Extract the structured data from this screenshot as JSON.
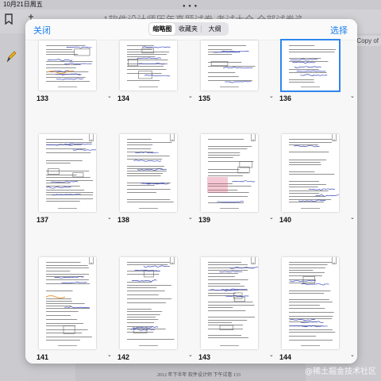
{
  "status_bar": {
    "date": "10月21日周五"
  },
  "background": {
    "title": "1软件设计师历年真题试卷 考试大全 全部试卷资源",
    "copy_label": "Copy of",
    "footer_text": "2012 年下半年  软件设计师  下午试卷                    133"
  },
  "watermark": "@稀土掘金技术社区",
  "header": {
    "close_label": "关闭",
    "select_label": "选择",
    "tabs": [
      {
        "label": "缩略图",
        "active": true
      },
      {
        "label": "收藏夹",
        "active": false
      },
      {
        "label": "大纲",
        "active": false
      }
    ]
  },
  "pages": [
    {
      "number": "133",
      "selected": false
    },
    {
      "number": "134",
      "selected": false
    },
    {
      "number": "135",
      "selected": false
    },
    {
      "number": "136",
      "selected": true
    },
    {
      "number": "137",
      "selected": false
    },
    {
      "number": "138",
      "selected": false
    },
    {
      "number": "139",
      "selected": false
    },
    {
      "number": "140",
      "selected": false
    },
    {
      "number": "141",
      "selected": false
    },
    {
      "number": "142",
      "selected": false
    },
    {
      "number": "143",
      "selected": false
    },
    {
      "number": "144",
      "selected": false
    }
  ],
  "colors": {
    "accent": "#1a7ff0",
    "selection": "#2f86ee",
    "ink_handwriting": "#3a47b8",
    "highlight_orange": "#e8a040",
    "highlight_pink": "#e06080"
  },
  "icons": [
    "bookmark-icon",
    "pencil-icon",
    "chevron-down-icon",
    "ruler-icon"
  ]
}
